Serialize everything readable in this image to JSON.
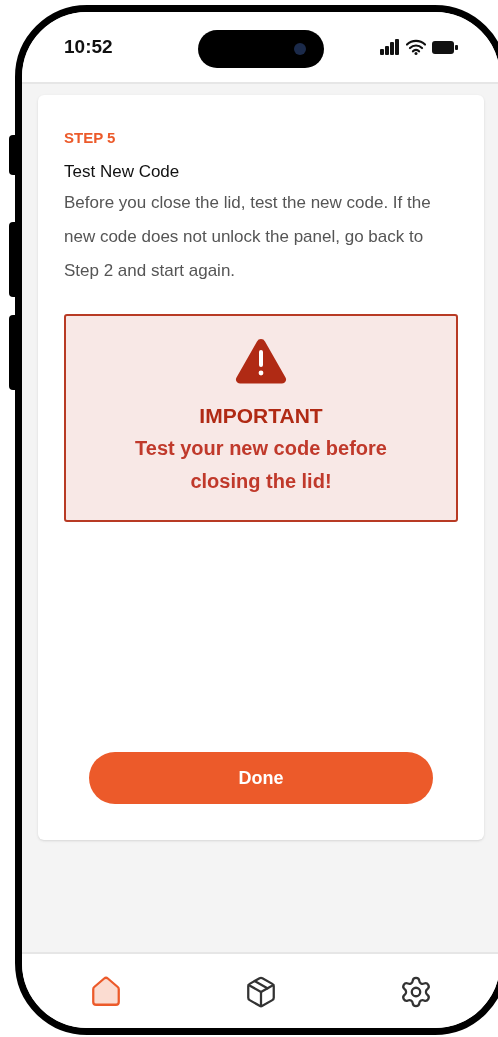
{
  "status_bar": {
    "time": "10:52"
  },
  "step": {
    "label": "STEP 5",
    "title": "Test New Code",
    "body": "Before you close the lid, test the new code. If the new code does not unlock the panel, go back to Step 2 and start again."
  },
  "alert": {
    "heading": "IMPORTANT",
    "message": "Test your new code before closing the lid!"
  },
  "done_button": "Done",
  "nav": [
    {
      "kind": "home",
      "selected": true
    },
    {
      "kind": "package",
      "selected": false
    },
    {
      "kind": "settings",
      "selected": false
    }
  ]
}
